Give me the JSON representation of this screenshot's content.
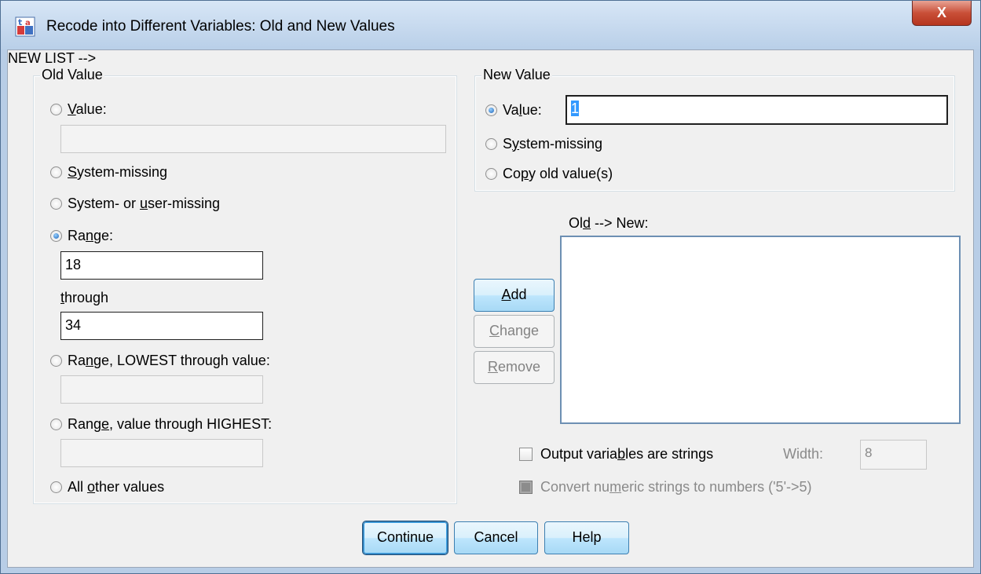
{
  "window": {
    "title": "Recode into Different Variables: Old and New Values",
    "close_label": "X",
    "icon": "recode-icon"
  },
  "old_value": {
    "legend": "Old Value",
    "value_radio": {
      "pre": "",
      "key": "V",
      "post": "alue:",
      "checked": false
    },
    "value_input": "",
    "system_missing": {
      "pre": "",
      "key": "S",
      "post": "ystem-missing",
      "checked": false
    },
    "system_user_missing": {
      "pre": "System- or ",
      "key": "u",
      "post": "ser-missing",
      "checked": false
    },
    "range": {
      "pre": "Ra",
      "key": "n",
      "post": "ge:",
      "checked": true
    },
    "range_from": "18",
    "through_label_pre": "",
    "through_label_key": "t",
    "through_label_post": "hrough",
    "range_to": "34",
    "range_lowest": {
      "pre": "Ra",
      "key": "n",
      "post": "ge, LOWEST through value:",
      "checked": false
    },
    "range_lowest_input": "",
    "range_highest": {
      "pre": "Rang",
      "key": "e",
      "post": ", value through HIGHEST:",
      "checked": false
    },
    "range_highest_input": "",
    "all_other": {
      "pre": "All ",
      "key": "o",
      "post": "ther values",
      "checked": false
    }
  },
  "new_value": {
    "legend": "New Value",
    "value_radio": {
      "pre": "Va",
      "key": "l",
      "post": "ue:",
      "checked": true
    },
    "value_input": "1",
    "system_missing": {
      "pre": "S",
      "key": "y",
      "post": "stem-missing",
      "checked": false
    },
    "copy_old": {
      "pre": "Co",
      "key": "p",
      "post": "y old value(s)",
      "checked": false
    }
  },
  "mapping": {
    "label_pre": "Ol",
    "label_key": "d",
    "label_post": " --> New:",
    "items": []
  },
  "buttons": {
    "add": {
      "key": "A",
      "post": "dd"
    },
    "change": {
      "key": "C",
      "post": "hange"
    },
    "remove": {
      "key": "R",
      "post": "emove"
    },
    "continue": "Continue",
    "cancel": "Cancel",
    "help": "Help"
  },
  "options": {
    "output_strings": {
      "pre": "Output varia",
      "key": "b",
      "post": "les are strings",
      "checked": false
    },
    "width_label": "Width:",
    "width_value": "8",
    "convert_numeric": {
      "pre": "Convert nu",
      "key": "m",
      "post": "eric strings to numbers ('5'->5)",
      "checked": false,
      "enabled": false
    }
  }
}
